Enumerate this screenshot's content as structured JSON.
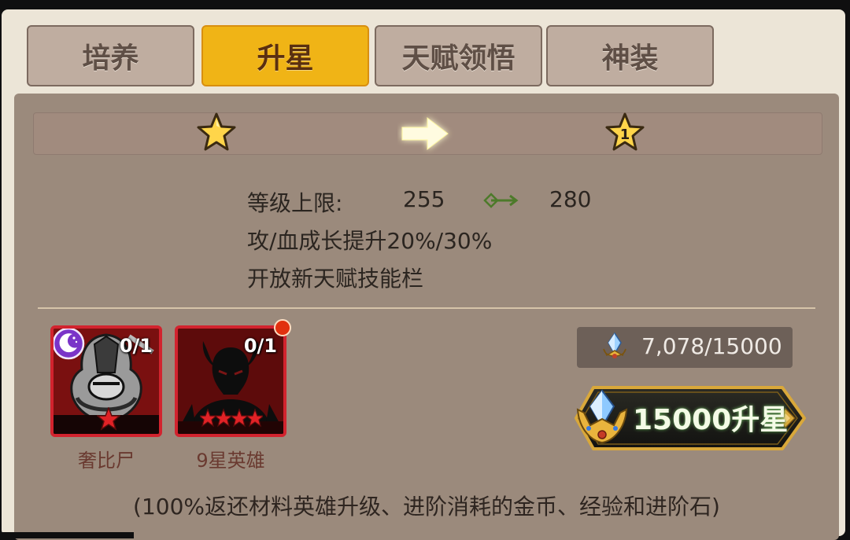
{
  "tabs": [
    {
      "label": "培养",
      "active": false
    },
    {
      "label": "升星",
      "active": true
    },
    {
      "label": "天赋领悟",
      "active": false
    },
    {
      "label": "神装",
      "active": false
    }
  ],
  "star_upgrade": {
    "current_star_icon": "star-icon",
    "arrow_icon": "arrow-right-icon",
    "next_star_label": "1"
  },
  "stats": {
    "level_cap_label": "等级上限:",
    "level_cap_from": "255",
    "level_cap_to": "280",
    "growth_text": "攻/血成长提升20%/30%",
    "talent_text": "开放新天赋技能栏"
  },
  "materials": [
    {
      "name": "奢比尸",
      "count": "0/1",
      "stars": 1,
      "badge": "moon-icon"
    },
    {
      "name": "9星英雄",
      "count": "0/1",
      "stars": 4,
      "badge": "red-dot"
    }
  ],
  "cost": {
    "icon": "crystal-crown-icon",
    "text": "7,078/15000"
  },
  "upgrade_button": {
    "label": "15000升星",
    "icon": "crystal-crown-icon"
  },
  "footer_note": "(100%返还材料英雄升级、进阶消耗的金币、经验和进阶石)",
  "colors": {
    "active_tab": "#f0b416",
    "panel": "#9b8a7c",
    "card_border": "#d2232e"
  }
}
